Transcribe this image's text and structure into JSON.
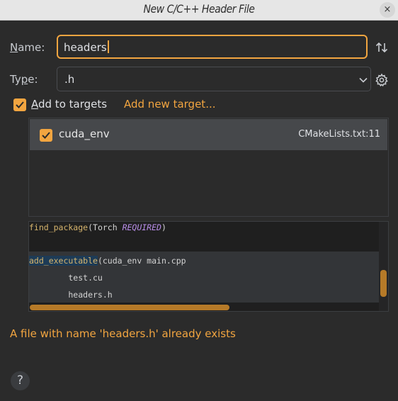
{
  "window": {
    "title": "New C/C++ Header File",
    "close_glyph": "×"
  },
  "form": {
    "name_label_mnemonic": "N",
    "name_label_rest": "ame:",
    "name_value": "headers",
    "type_label_mnemonic": "Ty",
    "type_label_underlined": "p",
    "type_label_rest": "e:",
    "type_value": ".h"
  },
  "targets": {
    "add_label_mnemonic": "A",
    "add_label_rest": "dd to targets",
    "add_checked": true,
    "add_new_link": "Add new target...",
    "items": [
      {
        "name": "cuda_env",
        "file": "CMakeLists.txt:11",
        "checked": true
      }
    ]
  },
  "code_preview": {
    "line1_fn": "find_package",
    "line1_open": "(Torch ",
    "line1_kw": "REQUIRED",
    "line1_close": ")",
    "line2_fn": "add_executable",
    "line2_rest": "(cuda_env main.cpp",
    "line3": "        test.cu",
    "line4": "        headers.h"
  },
  "error_message": "A file with name 'headers.h' already exists",
  "help_glyph": "?",
  "colors": {
    "accent": "#f2a540",
    "background": "#2b2b2b",
    "selection": "#46484b"
  },
  "icons": [
    "close-icon",
    "sort-icon",
    "chevron-down-icon",
    "gear-icon",
    "checkmark-icon",
    "help-icon"
  ]
}
